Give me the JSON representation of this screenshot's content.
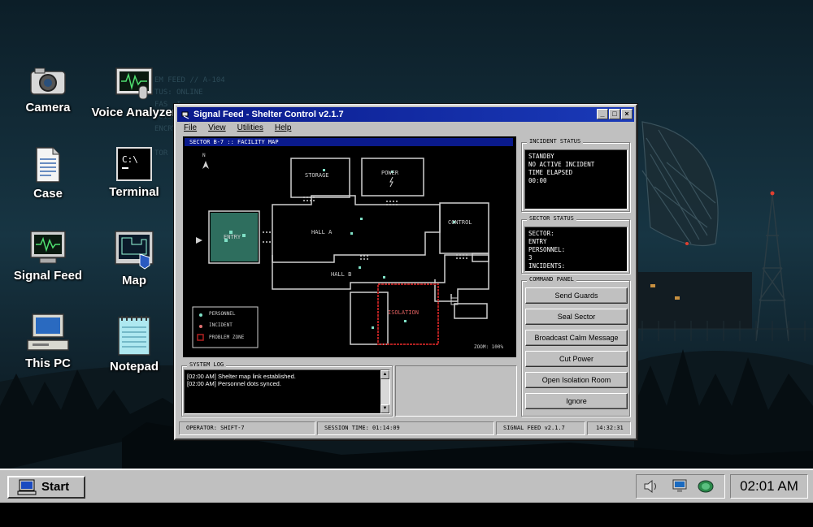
{
  "colors": {
    "title_bar": "#0a1a8c",
    "map_walls": "#cfcfcf",
    "entry_room": "#2e6e5e",
    "personnel_dot": "#7fe0c6",
    "incident_dot": "#e07070",
    "problem_zone": "#b02020"
  },
  "background_text": "EM FEED // A-104\nTUS: ONLINE\nFAS  I\nNOISE F\nENCRYPT\n\nTOR",
  "desktop_icons": [
    {
      "label": "Camera",
      "icon": "camera-icon"
    },
    {
      "label": "Voice Analyzer",
      "icon": "voice-analyzer-icon"
    },
    {
      "label": "Case",
      "icon": "document-icon"
    },
    {
      "label": "Terminal",
      "icon": "terminal-icon"
    },
    {
      "label": "Signal Feed",
      "icon": "signal-monitor-icon"
    },
    {
      "label": "Map",
      "icon": "map-icon"
    },
    {
      "label": "This PC",
      "icon": "computer-icon"
    },
    {
      "label": "Notepad",
      "icon": "notepad-icon"
    }
  ],
  "window": {
    "title": "Signal Feed - Shelter Control v2.1.7",
    "controls": {
      "minimize": "_",
      "maximize": "□",
      "close": "×"
    },
    "menu": [
      "File",
      "View",
      "Utilities",
      "Help"
    ]
  },
  "map": {
    "title": "SECTOR B-7 :: FACILITY MAP",
    "north": "N",
    "rooms": {
      "storage": "STORAGE",
      "power": "POWER",
      "control": "CONTROL",
      "entry": "ENTRY",
      "hall_a": "HALL A",
      "hall_b": "HALL B",
      "isolation": "ISOLATION"
    },
    "legend": {
      "personnel": "PERSONNEL",
      "incident": "INCIDENT",
      "problem_zone": "PROBLEM ZONE"
    },
    "zoom": "ZOOM: 100%"
  },
  "incident_status": {
    "title": "INCIDENT STATUS",
    "lines": [
      "STANDBY",
      "NO ACTIVE INCIDENT",
      "TIME ELAPSED",
      "00:00"
    ]
  },
  "sector_status": {
    "title": "SECTOR STATUS",
    "lines": [
      "SECTOR:",
      "ENTRY",
      "PERSONNEL:",
      "3",
      "INCIDENTS:"
    ]
  },
  "command_panel": {
    "title": "COMMAND PANEL",
    "buttons": [
      "Send Guards",
      "Seal Sector",
      "Broadcast Calm Message",
      "Cut Power",
      "Open Isolation Room",
      "Ignore"
    ]
  },
  "system_log": {
    "title": "SYSTEM LOG",
    "entries": [
      "[02:00 AM] Shelter map link established.",
      "[02:00 AM] Personnel dots synced."
    ]
  },
  "status_bar": {
    "operator": "OPERATOR:    SHIFT-7",
    "session": "SESSION TIME:  01:14:09",
    "version": "SIGNAL FEED v2.1.7",
    "time": "14:32:31"
  },
  "taskbar": {
    "start_label": "Start",
    "clock": "02:01 AM",
    "tray_icons": [
      "speaker-icon",
      "network-icon",
      "globe-icon"
    ]
  }
}
